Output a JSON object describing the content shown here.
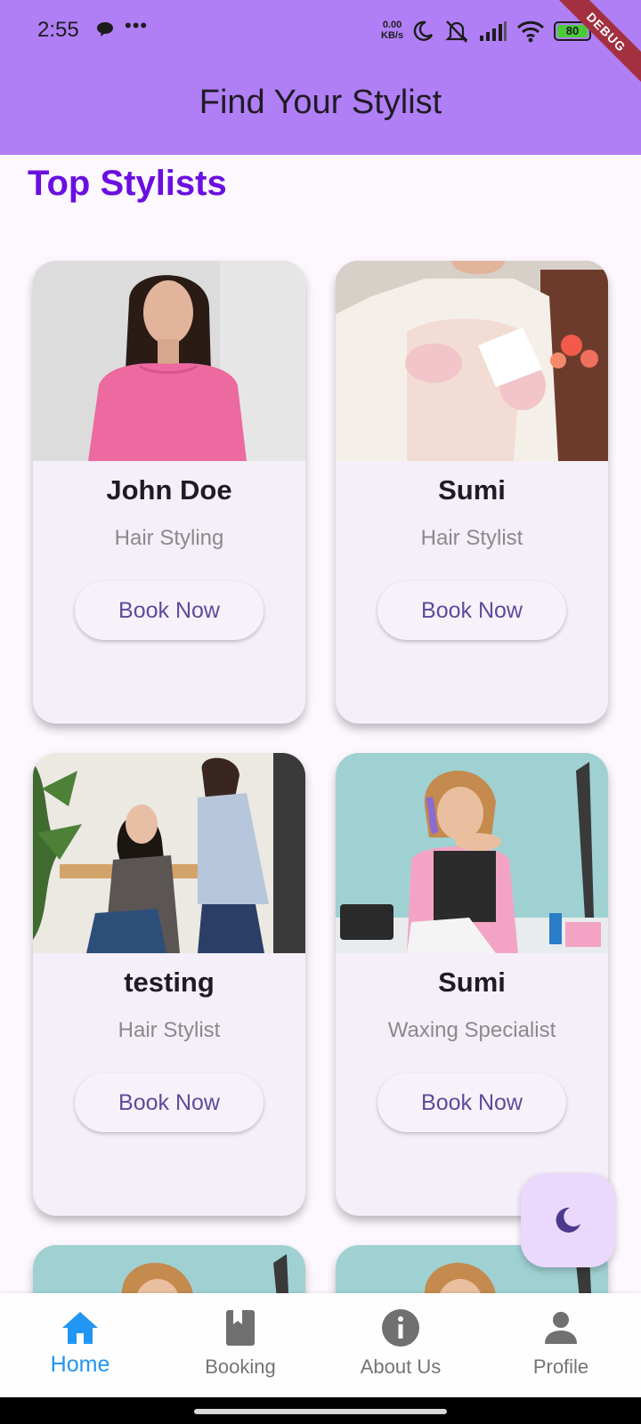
{
  "status_bar": {
    "time": "2:55",
    "network_speed_value": "0.00",
    "network_speed_unit": "KB/s",
    "battery": "80",
    "debug_banner": "DEBUG"
  },
  "app_bar": {
    "title": "Find Your Stylist"
  },
  "section": {
    "title": "Top Stylists"
  },
  "stylists": [
    {
      "name": "John Doe",
      "specialty": "Hair Styling",
      "button": "Book Now"
    },
    {
      "name": "Sumi",
      "specialty": "Hair Stylist",
      "button": "Book Now"
    },
    {
      "name": "testing",
      "specialty": "Hair Stylist",
      "button": "Book Now"
    },
    {
      "name": "Sumi",
      "specialty": "Waxing Specialist",
      "button": "Book Now"
    }
  ],
  "fab": {
    "icon": "moon-icon"
  },
  "bottom_nav": {
    "items": [
      {
        "label": "Home",
        "icon": "home-icon",
        "active": true
      },
      {
        "label": "Booking",
        "icon": "book-icon",
        "active": false
      },
      {
        "label": "About Us",
        "icon": "info-icon",
        "active": false
      },
      {
        "label": "Profile",
        "icon": "person-icon",
        "active": false
      }
    ]
  },
  "colors": {
    "app_bar": "#b07ff5",
    "section_title": "#6a0fe0",
    "active_nav": "#2196f3",
    "book_button_text": "#5d4b9c"
  }
}
